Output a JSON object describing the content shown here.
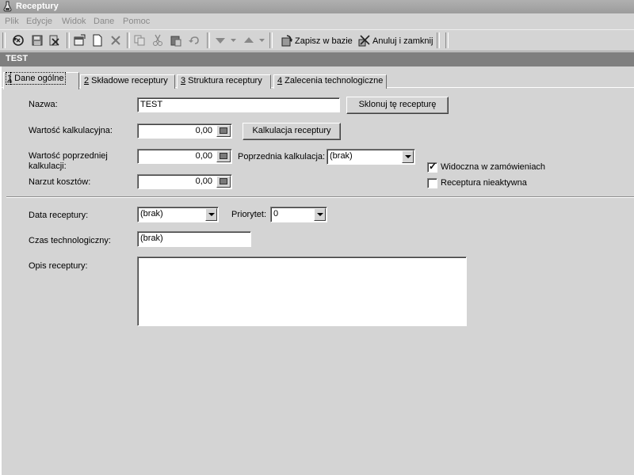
{
  "window": {
    "title": "Receptury"
  },
  "menu": [
    "Plik",
    "Edycje",
    "Widok",
    "Dane",
    "Pomoc"
  ],
  "toolbar": {
    "save_db_label": "Zapisz w bazie",
    "cancel_close_label": "Anuluj i zamknij"
  },
  "record": {
    "name": "TEST"
  },
  "tabs": [
    {
      "key": "1",
      "label": " Dane ogólne"
    },
    {
      "key": "2",
      "label": " Składowe receptury"
    },
    {
      "key": "3",
      "label": " Struktura receptury"
    },
    {
      "key": "4",
      "label": " Zalecenia technologiczne"
    }
  ],
  "form": {
    "nazwa_label": "Nazwa:",
    "nazwa_value": "TEST",
    "clone_button": "Sklonuj tę recepturę",
    "wartosc_kalk_label": "Wartość kalkulacyjna:",
    "wartosc_kalk_value": "0,00",
    "kalkulacja_button": "Kalkulacja receptury",
    "wartosc_poprz_label": "Wartość poprzedniej kalkulacji:",
    "wartosc_poprz_value": "0,00",
    "poprzednia_kalk_label": "Poprzednia kalkulacja:",
    "poprzednia_kalk_value": "(brak)",
    "narzut_label": "Narzut kosztów:",
    "narzut_value": "0,00",
    "widoczna_label": "Widoczna w zamówieniach",
    "widoczna_checked": true,
    "nieaktywna_label": "Receptura nieaktywna",
    "nieaktywna_checked": false,
    "data_label": "Data receptury:",
    "data_value": "(brak)",
    "priorytet_label": "Priorytet:",
    "priorytet_value": "0",
    "czas_label": "Czas technologiczny:",
    "czas_value": "(brak)",
    "opis_label": "Opis receptury:",
    "opis_value": ""
  }
}
